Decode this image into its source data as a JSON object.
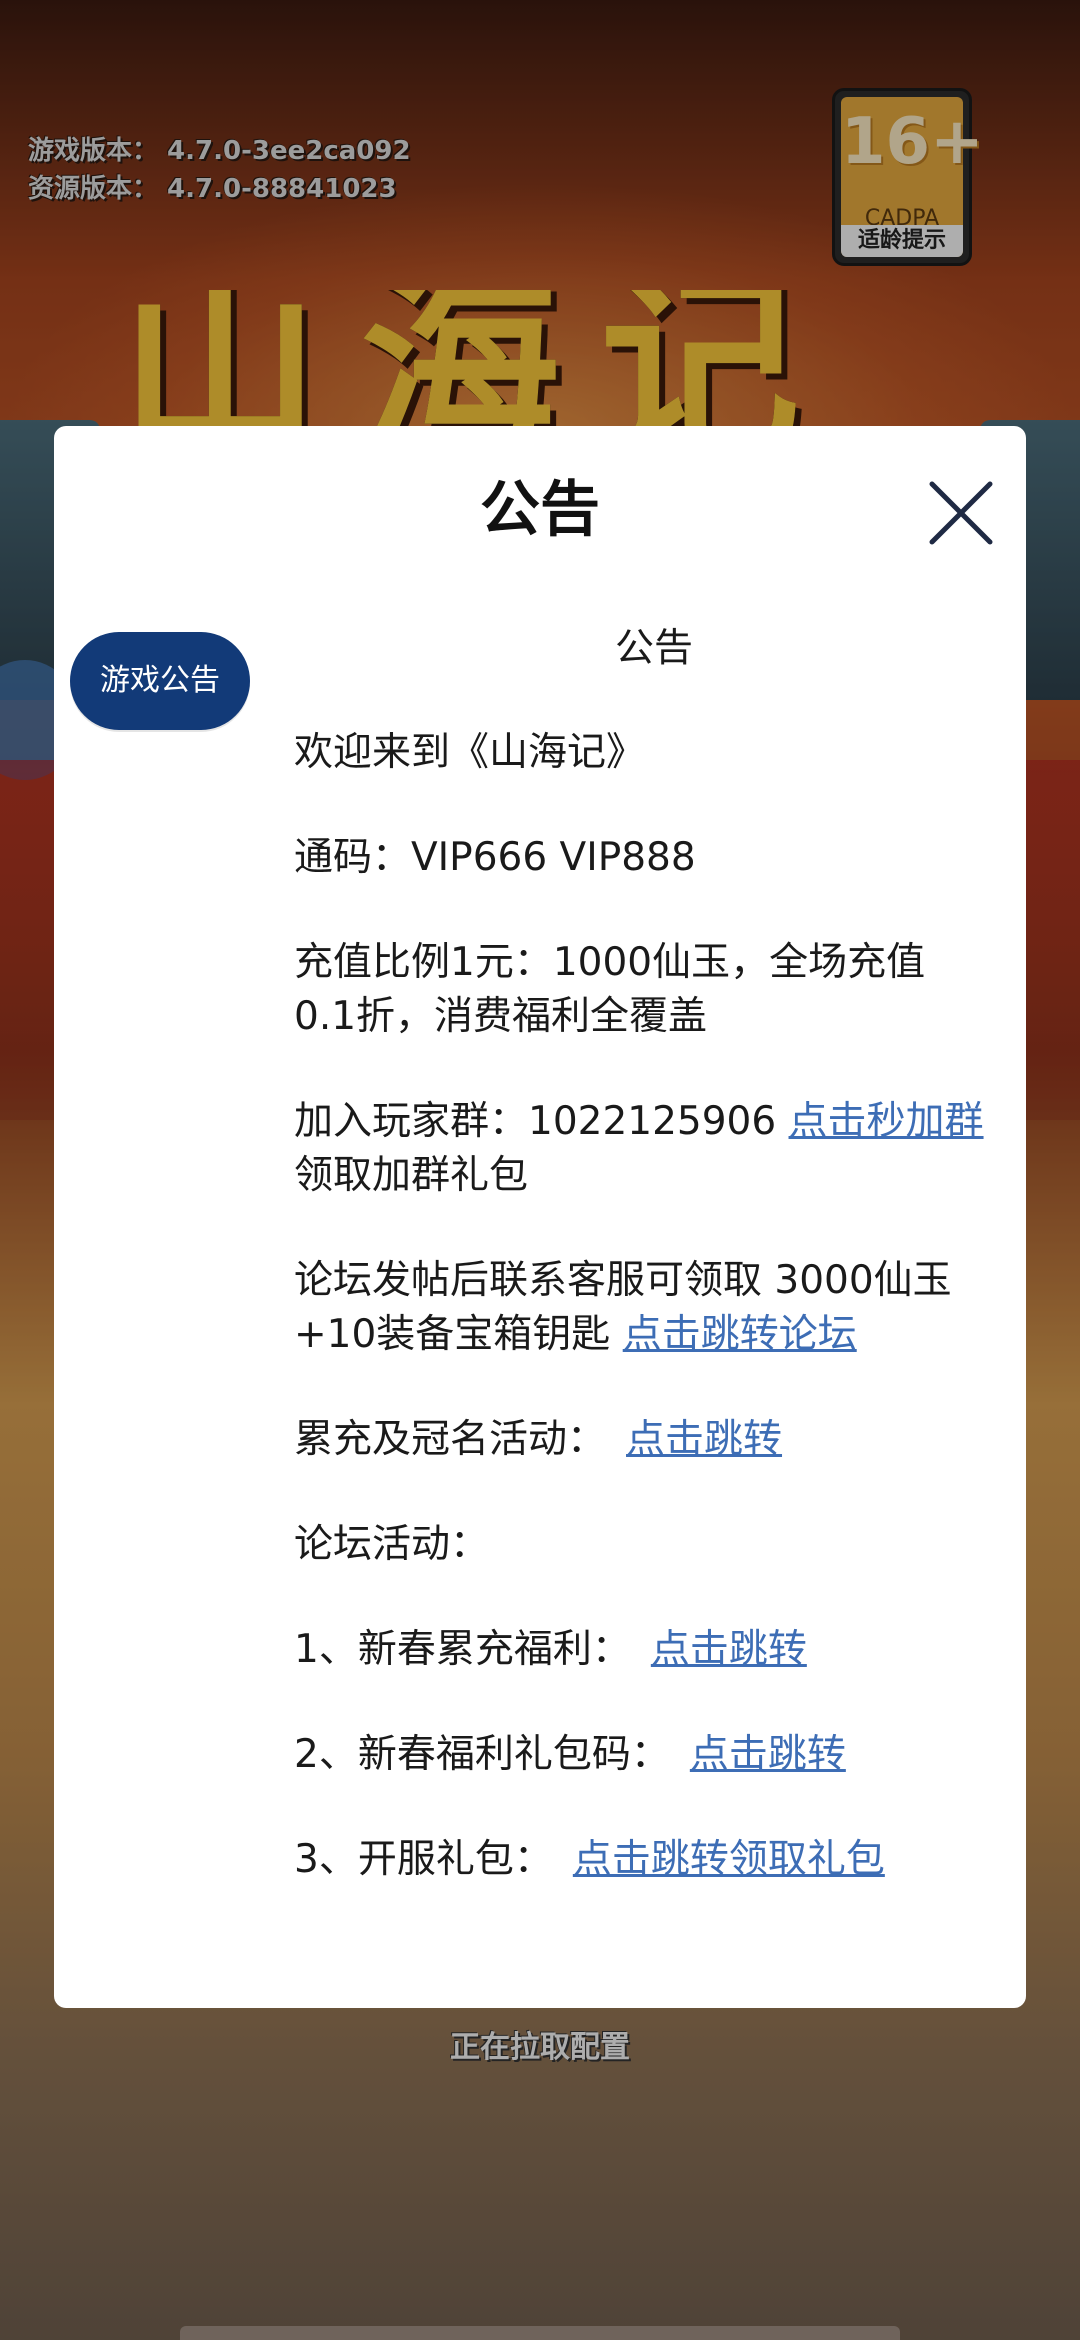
{
  "background": {
    "version_game": "游戏版本： 4.7.0-3ee2ca092",
    "version_resource": "资源版本： 4.7.0-88841023",
    "age_rating": "16+",
    "age_org": "CADPA",
    "age_label": "适龄提示",
    "loading_text": "正在拉取配置"
  },
  "modal": {
    "title": "公告",
    "tab_label": "游戏公告",
    "heading": "公告",
    "welcome": "欢迎来到《山海记》",
    "code_line": "通码：VIP666 VIP888",
    "recharge_line": "充值比例1元：1000仙玉，全场充值0.1折，消费福利全覆盖",
    "group_text": "加入玩家群：1022125906 ",
    "group_link": "点击秒加群",
    "group_suffix": " 领取加群礼包",
    "forum_text": "论坛发帖后联系客服可领取 3000仙玉+10装备宝箱钥匙 ",
    "forum_link": "点击跳转论坛",
    "accum_text": "累充及冠名活动：",
    "accum_link": "点击跳转",
    "forum_activity": "论坛活动：",
    "item1_text": "1、新春累充福利：",
    "item1_link": "点击跳转",
    "item2_text": "2、新春福利礼包码：",
    "item2_link": "点击跳转",
    "item3_text": "3、开服礼包：",
    "item3_link": "点击跳转领取礼包"
  },
  "colors": {
    "tab_bg": "#123a78",
    "link": "#3d6db5"
  }
}
